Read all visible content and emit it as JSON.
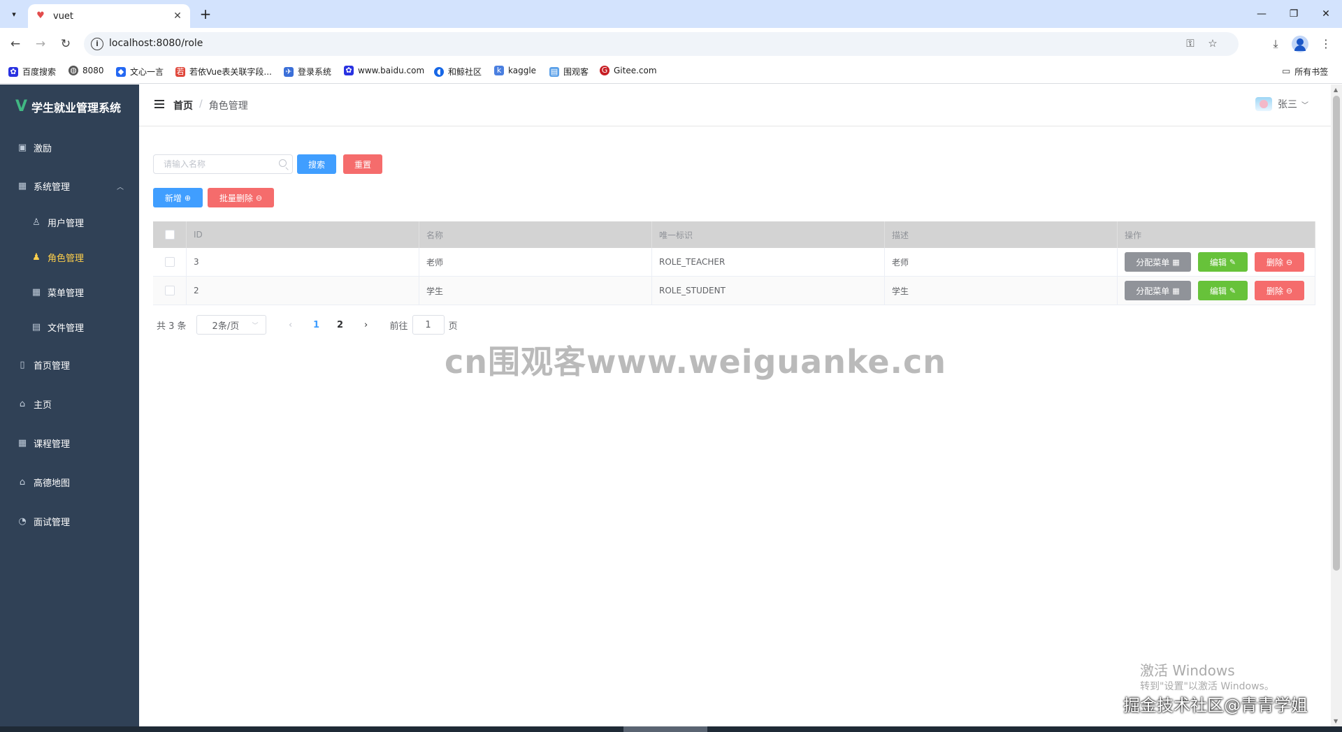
{
  "browser": {
    "tab_title": "vuet",
    "url": "localhost:8080/role",
    "bookmarks": [
      {
        "label": "百度搜索",
        "icon": "paw-icon",
        "color": "#2932e1"
      },
      {
        "label": "8080",
        "icon": "globe-icon",
        "color": "#555555"
      },
      {
        "label": "文心一言",
        "icon": "cube-icon",
        "color": "#2468f2"
      },
      {
        "label": "若依Vue表关联字段...",
        "icon": "ruoyi-icon",
        "color": "#e0463a"
      },
      {
        "label": "登录系统",
        "icon": "bird-icon",
        "color": "#3b6fd8"
      },
      {
        "label": "www.baidu.com",
        "icon": "paw-icon",
        "color": "#2932e1"
      },
      {
        "label": "和鲸社区",
        "icon": "whale-icon",
        "color": "#1767e6"
      },
      {
        "label": "kaggle",
        "icon": "kaggle-icon",
        "color": "#4a7fe0"
      },
      {
        "label": "围观客",
        "icon": "page-icon",
        "color": "#5aa0e8"
      },
      {
        "label": "Gitee.com",
        "icon": "gitee-icon",
        "color": "#c71d23"
      }
    ],
    "all_bookmarks": "所有书签"
  },
  "sidebar": {
    "brand": "学生就业管理系统",
    "items": [
      {
        "label": "激励",
        "icon": "chart-icon"
      },
      {
        "label": "系统管理",
        "icon": "grid-icon"
      },
      {
        "label": "用户管理",
        "icon": "user-icon"
      },
      {
        "label": "角色管理",
        "icon": "user-filled-icon"
      },
      {
        "label": "菜单管理",
        "icon": "menu-icon"
      },
      {
        "label": "文件管理",
        "icon": "document-icon"
      },
      {
        "label": "首页管理",
        "icon": "trash-icon"
      },
      {
        "label": "主页",
        "icon": "house-icon"
      },
      {
        "label": "课程管理",
        "icon": "grid-icon"
      },
      {
        "label": "高德地图",
        "icon": "house-icon"
      },
      {
        "label": "面试管理",
        "icon": "trend-icon"
      }
    ]
  },
  "header": {
    "breadcrumb_home": "首页",
    "breadcrumb_sep": "/",
    "breadcrumb_current": "角色管理",
    "username": "张三"
  },
  "toolbar": {
    "search_placeholder": "请输入名称",
    "search_button": "搜索",
    "reset_button": "重置",
    "add_button": "新增",
    "batch_delete_button": "批量删除"
  },
  "table": {
    "columns": [
      "ID",
      "名称",
      "唯一标识",
      "描述",
      "操作"
    ],
    "rows": [
      {
        "id": "3",
        "name": "老师",
        "flag": "ROLE_TEACHER",
        "desc": "老师"
      },
      {
        "id": "2",
        "name": "学生",
        "flag": "ROLE_STUDENT",
        "desc": "学生"
      }
    ],
    "actions": {
      "assign_menu": "分配菜单",
      "edit": "编辑",
      "delete": "删除"
    }
  },
  "pagination": {
    "total": "共 3 条",
    "page_size": "2条/页",
    "pages": [
      "1",
      "2"
    ],
    "current_page": "1",
    "goto_label": "前往",
    "goto_value": "1",
    "goto_suffix": "页"
  },
  "overlays": {
    "watermark": "cn围观客www.weiguanke.cn",
    "activate_title": "激活 Windows",
    "activate_sub": "转到\"设置\"以激活 Windows。",
    "juejin": "掘金技术社区@青青学姐"
  },
  "colors": {
    "sidebar_bg": "#304156",
    "active_menu": "#ffd04b",
    "primary": "#409eff",
    "danger": "#f56c6c",
    "success": "#67c23a",
    "info": "#909399"
  }
}
